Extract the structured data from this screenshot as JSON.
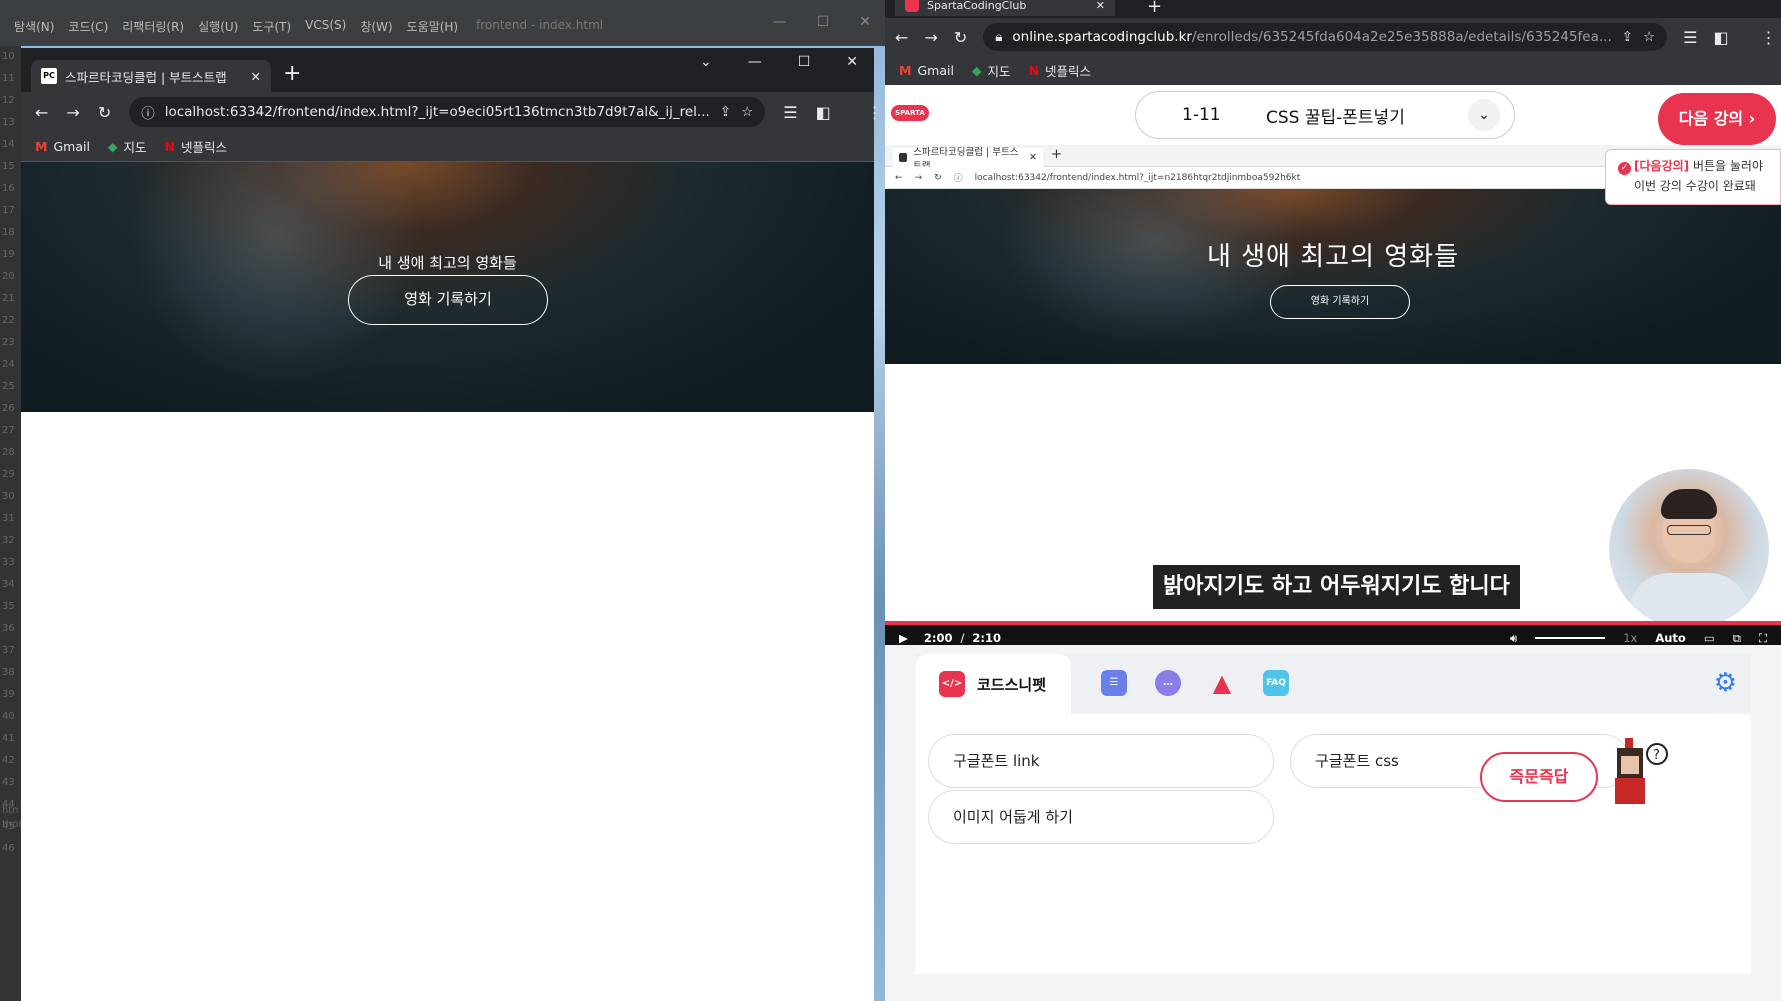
{
  "ide": {
    "menu": [
      "탐색(N)",
      "코드(C)",
      "리팩터링(R)",
      "실행(U)",
      "도구(T)",
      "VCS(S)",
      "창(W)",
      "도움말(H)"
    ],
    "title": "frontend - index.html",
    "line_numbers": [
      "10",
      "11",
      "12",
      "13",
      "14",
      "15",
      "16",
      "17",
      "18",
      "19",
      "20",
      "21",
      "22",
      "23",
      "24",
      "25",
      "26",
      "27",
      "28",
      "29",
      "30",
      "31",
      "32",
      "33",
      "34",
      "35",
      "36",
      "37",
      "38",
      "39",
      "40",
      "41",
      "42",
      "43",
      "44",
      "45",
      "46"
    ],
    "side_text": [
      "htn",
      "thor"
    ]
  },
  "left_browser": {
    "tab_title": "스파르타코딩클럽 | 부트스트랩",
    "tab_favicon": "PC",
    "url": "localhost:63342/frontend/index.html?_ijt=o9eci05rt136tmcn3tb7d9t7al&_ij_rel...",
    "bookmarks": [
      "Gmail",
      "지도",
      "넷플릭스"
    ],
    "hero_title": "내 생애 최고의 영화들",
    "hero_button": "영화 기록하기"
  },
  "right_browser": {
    "tab_title": "SpartaCodingClub",
    "url_host": "online.spartacodingclub.kr",
    "url_path": "/enrolleds/635245fda604a2e25e35888a/edetails/635245fea...",
    "bookmarks": [
      "Gmail",
      "지도",
      "넷플릭스"
    ],
    "logo": "SPARTA",
    "lesson_number": "1-11",
    "lesson_title": "CSS 꿀팁-폰트넣기",
    "next_button": "다음 강의",
    "toast_highlight": "[다음강의]",
    "toast_line1": " 버튼을 눌러야",
    "toast_line2": "이번 강의 수강이 완료돼",
    "video": {
      "inner_tab": "스파르타코딩클럽 | 부트스트랩",
      "inner_url": "localhost:63342/frontend/index.html?_ijt=n2186htqr2tdjinmboa592h6kt",
      "hero_title": "내 생애 최고의 영화들",
      "hero_button": "영화 기록하기",
      "caption": "밝아지기도 하고 어두워지기도 합니다",
      "current_time": "2:00",
      "separator": "/",
      "duration": "2:10",
      "speed": "1x",
      "quality": "Auto"
    },
    "panel": {
      "active_tab": "코드스니펫",
      "faq_label": "FAQ",
      "snippets": [
        "구글폰트 link",
        "구글폰트 css",
        "이미지 어둡게 하기"
      ],
      "quick_answer": "즉문즉답"
    }
  },
  "colors": {
    "accent": "#e8344e",
    "chrome_dark": "#202124",
    "chrome_mid": "#35363a"
  }
}
